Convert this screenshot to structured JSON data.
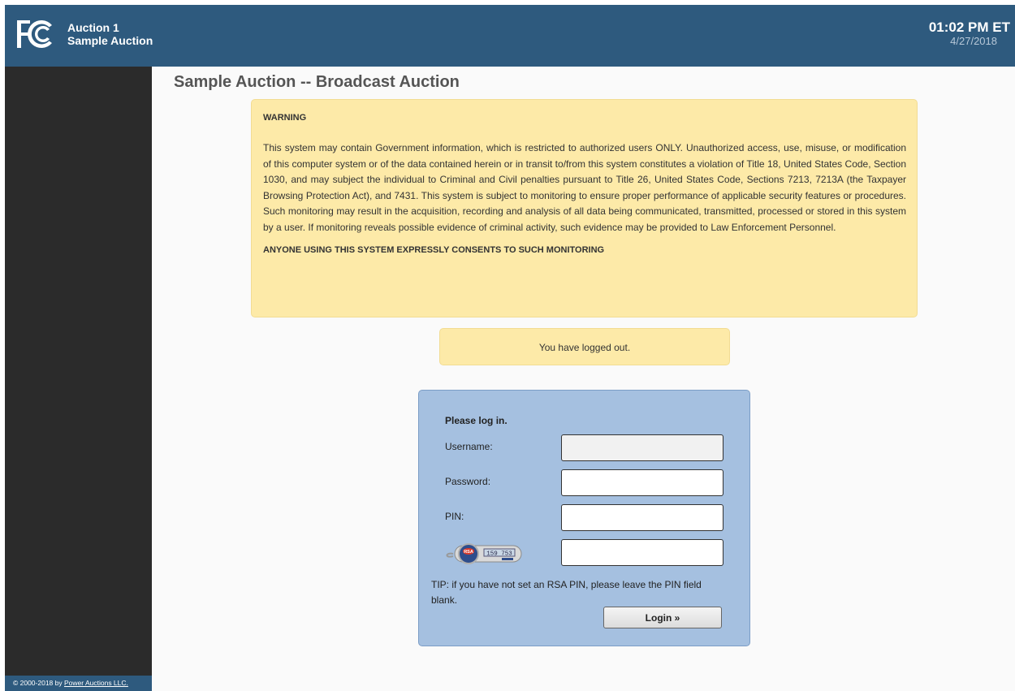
{
  "header": {
    "logo_alt": "FCC",
    "auction_name": "Auction 1",
    "auction_subtitle": "Sample Auction",
    "time": "01:02 PM ET",
    "date": "4/27/2018"
  },
  "sidebar": {
    "copyright_prefix": "© 2000-2018 by ",
    "copyright_link": "Power Auctions LLC."
  },
  "main": {
    "page_title": "Sample Auction -- Broadcast Auction",
    "warning": {
      "heading": "WARNING",
      "body": "This system may contain Government information, which is restricted to authorized users ONLY. Unauthorized access, use, misuse, or modification of this computer system or of the data contained herein or in transit to/from this system constitutes a violation of Title 18, United States Code, Section 1030, and may subject the individual to Criminal and Civil penalties pursuant to Title 26, United States Code, Sections 7213, 7213A (the Taxpayer Browsing Protection Act), and 7431. This system is subject to monitoring to ensure proper performance of applicable security features or procedures. Such monitoring may result in the acquisition, recording and analysis of all data being communicated, transmitted, processed or stored in this system by a user. If monitoring reveals possible evidence of criminal activity, such evidence may be provided to Law Enforcement Personnel.",
      "consent": "ANYONE USING THIS SYSTEM EXPRESSLY CONSENTS TO SUCH MONITORING"
    },
    "logout_message": "You have logged out.",
    "login": {
      "heading": "Please log in.",
      "username_label": "Username:",
      "username_value": "",
      "password_label": "Password:",
      "password_value": "",
      "pin_label": "PIN:",
      "pin_value": "",
      "token_icon": "rsa-securid-token-icon",
      "token_value": "",
      "tip": "TIP: if you have not set an RSA PIN, please leave the PIN field blank.",
      "login_button": "Login »"
    }
  },
  "colors": {
    "header_bg": "#2e5a7e",
    "sidebar_bg": "#2b2b2b",
    "warning_bg": "#fdeaa8",
    "login_bg": "#a5c0e0"
  }
}
